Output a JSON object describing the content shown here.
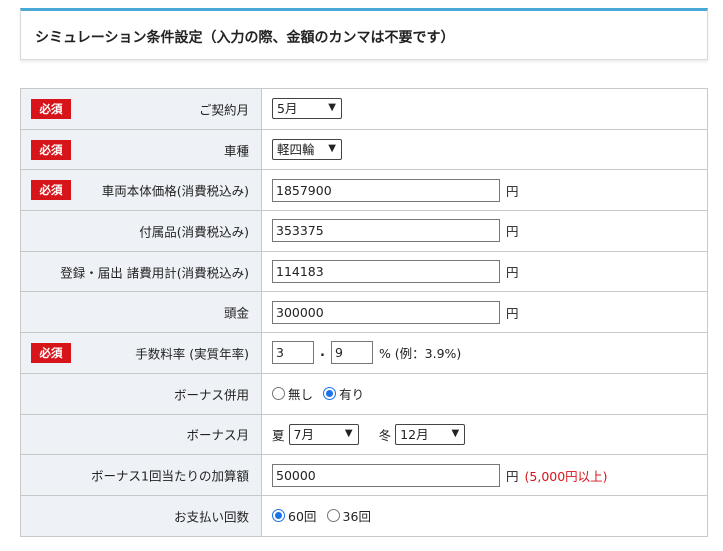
{
  "header": {
    "title": "シミュレーション条件設定（入力の際、金額のカンマは不要です）"
  },
  "required_badge": "必須",
  "rows": {
    "contract_month": {
      "label": "ご契約月",
      "value": "5月"
    },
    "vehicle_type": {
      "label": "車種",
      "value": "軽四輪"
    },
    "vehicle_price": {
      "label": "車両本体価格(消費税込み)",
      "value": "1857900",
      "unit": "円"
    },
    "accessories": {
      "label": "付属品(消費税込み)",
      "value": "353375",
      "unit": "円"
    },
    "registration": {
      "label": "登録・届出 諸費用計(消費税込み)",
      "value": "114183",
      "unit": "円"
    },
    "down_payment": {
      "label": "頭金",
      "value": "300000",
      "unit": "円"
    },
    "fee_rate": {
      "label": "手数料率 (実質年率)",
      "integer": "3",
      "separator": ".",
      "decimal": "9",
      "suffix": "% (例：3.9%)"
    },
    "bonus_use": {
      "label": "ボーナス併用",
      "options": [
        "無し",
        "有り"
      ],
      "selected": "有り"
    },
    "bonus_month": {
      "label": "ボーナス月",
      "summer_label": "夏",
      "summer_value": "7月",
      "winter_label": "冬",
      "winter_value": "12月"
    },
    "bonus_amount": {
      "label": "ボーナス1回当たりの加算額",
      "value": "50000",
      "unit": "円",
      "note": "(5,000円以上)"
    },
    "payment_count": {
      "label": "お支払い回数",
      "options": [
        "60回",
        "36回"
      ],
      "selected": "60回"
    }
  },
  "colors": {
    "required_bg": "#d7141a",
    "label_bg": "#eef2f6",
    "header_accent": "#4aa8d8",
    "radio_checked": "#1a73e8"
  }
}
